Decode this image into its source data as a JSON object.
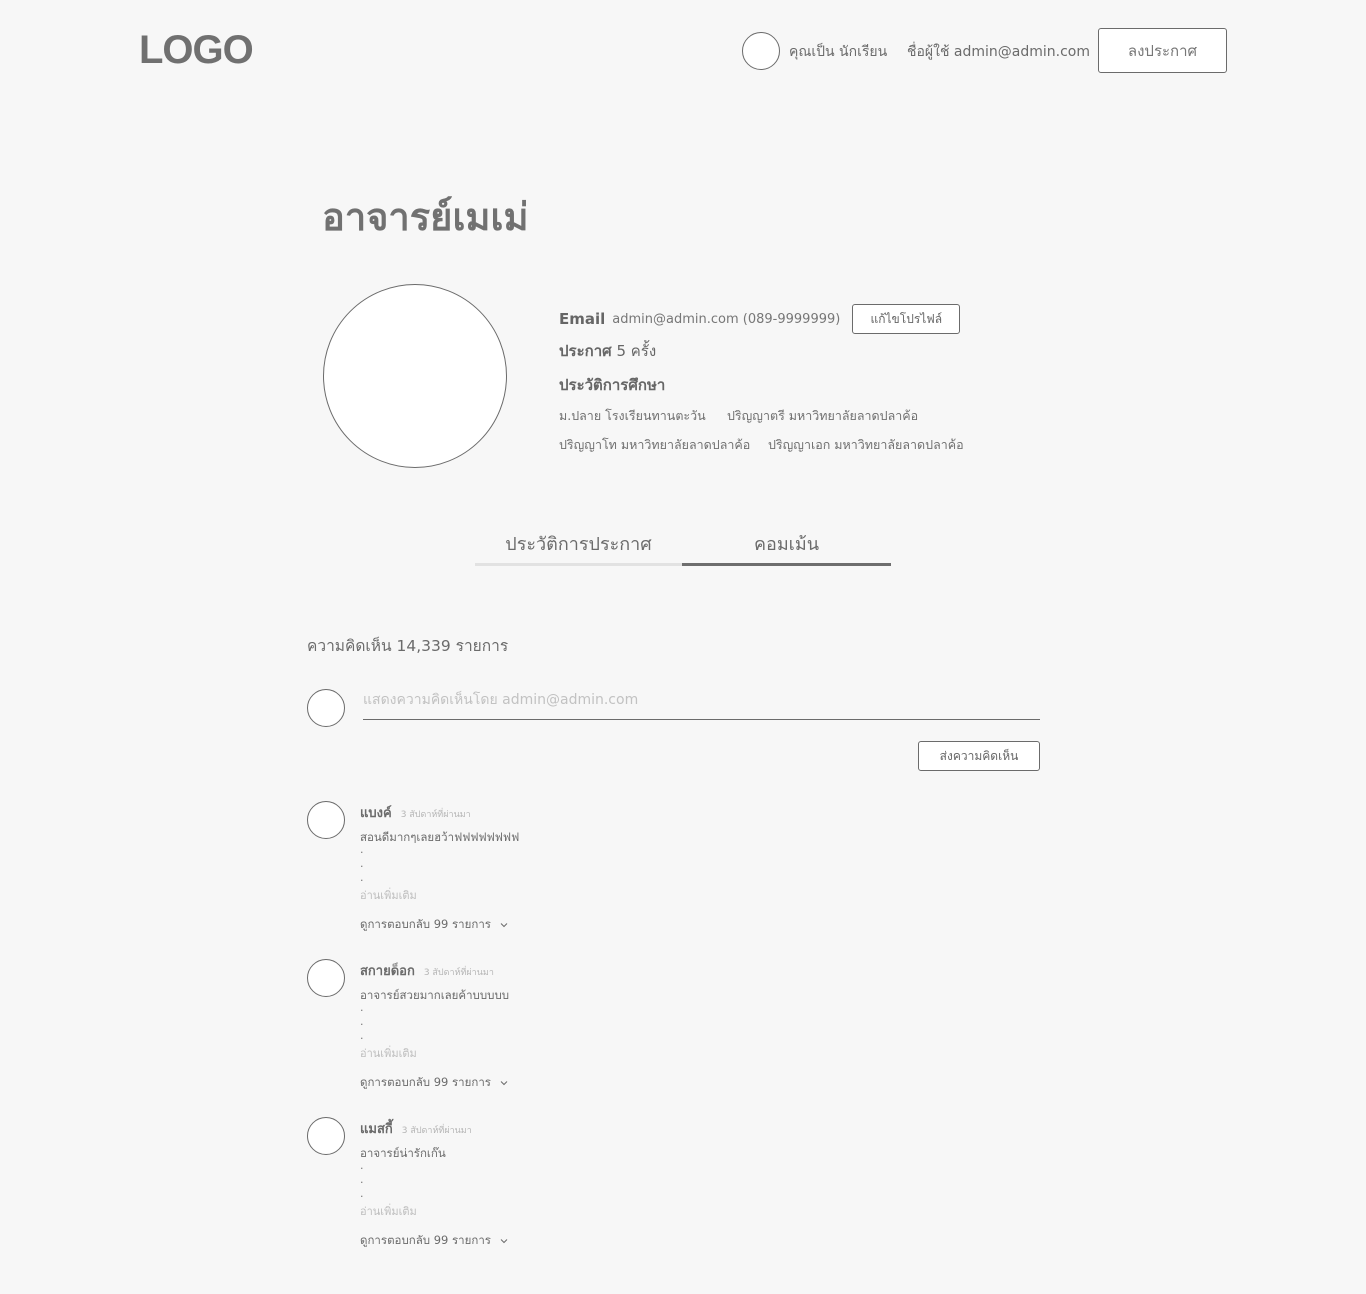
{
  "header": {
    "logo": "LOGO",
    "role_text": "คุณเป็น นักเรียน",
    "user_text": "ชื่อผู้ใช้ admin@admin.com",
    "post_button": "ลงประกาศ"
  },
  "profile": {
    "name": "อาจารย์เมเม่",
    "email_label": "Email",
    "email_value": "admin@admin.com (089-9999999)",
    "edit_button": "แก้ไขโปรไฟล์",
    "post_label": "ประกาศ",
    "post_value": "5 ครั้ง",
    "education_title": "ประวัติการศึกษา",
    "education": [
      "ม.ปลาย โรงเรียนทานตะวัน",
      "ปริญญาตรี มหาวิทยาลัยลาดปลาค้อ",
      "ปริญญาโท มหาวิทยาลัยลาดปลาค้อ",
      "ปริญญาเอก มหาวิทยาลัยลาดปลาค้อ"
    ]
  },
  "tabs": [
    {
      "label": "ประวัติการประกาศ",
      "active": false
    },
    {
      "label": "คอมเม้น",
      "active": true
    }
  ],
  "comments_section": {
    "count_text": "ความคิดเห็น 14,339 รายการ",
    "input_placeholder": "แสดงความคิดเห็นโดย admin@admin.com",
    "send_button": "ส่งความคิดเห็น",
    "read_more": "อ่านเพิ่มเติม",
    "items": [
      {
        "name": "แบงค์",
        "time": "3 สัปดาห์ที่ผ่านมา",
        "text": "สอนดีมากๆเลยฮว้าฟฟฟฟฟฟฟฟ",
        "replies": "ดูการตอบกลับ 99 รายการ"
      },
      {
        "name": "สกายด็อก",
        "time": "3 สัปดาห์ที่ผ่านมา",
        "text": "อาจารย์สวยมากเลยค้าบบบบบ",
        "replies": "ดูการตอบกลับ 99 รายการ"
      },
      {
        "name": "แมสกี้",
        "time": "3 สัปดาห์ที่ผ่านมา",
        "text": "อาจารย์น่ารักเก๊น",
        "replies": "ดูการตอบกลับ 99 รายการ"
      }
    ]
  },
  "icons": {
    "replies_toggle": "chevron-down-icon"
  }
}
